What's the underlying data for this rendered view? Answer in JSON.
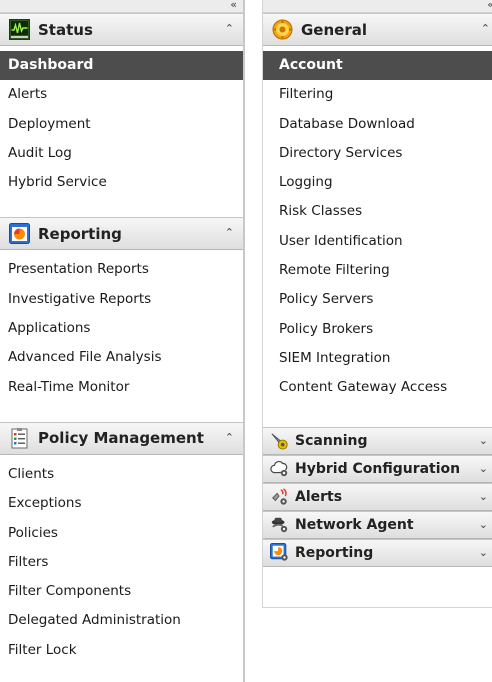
{
  "collapse_glyph": "«",
  "left_panel": {
    "sections": [
      {
        "title": "Status",
        "icon": "status-monitor-icon",
        "state": "expanded",
        "items": [
          {
            "label": "Dashboard",
            "active": true
          },
          {
            "label": "Alerts"
          },
          {
            "label": "Deployment"
          },
          {
            "label": "Audit Log"
          },
          {
            "label": "Hybrid Service"
          }
        ]
      },
      {
        "title": "Reporting",
        "icon": "reporting-chart-icon",
        "state": "expanded",
        "items": [
          {
            "label": "Presentation Reports"
          },
          {
            "label": "Investigative Reports"
          },
          {
            "label": "Applications"
          },
          {
            "label": "Advanced File Analysis"
          },
          {
            "label": "Real-Time Monitor"
          }
        ]
      },
      {
        "title": "Policy Management",
        "icon": "policy-list-icon",
        "state": "expanded",
        "items": [
          {
            "label": "Clients"
          },
          {
            "label": "Exceptions"
          },
          {
            "label": "Policies"
          },
          {
            "label": "Filters"
          },
          {
            "label": "Filter Components"
          },
          {
            "label": "Delegated Administration"
          },
          {
            "label": "Filter Lock"
          }
        ]
      }
    ]
  },
  "right_panel": {
    "general": {
      "title": "General",
      "icon": "general-gear-icon",
      "state": "expanded",
      "items": [
        {
          "label": "Account",
          "active": true
        },
        {
          "label": "Filtering"
        },
        {
          "label": "Database Download"
        },
        {
          "label": "Directory Services"
        },
        {
          "label": "Logging"
        },
        {
          "label": "Risk Classes"
        },
        {
          "label": "User Identification"
        },
        {
          "label": "Remote Filtering"
        },
        {
          "label": "Policy Servers"
        },
        {
          "label": "Policy Brokers"
        },
        {
          "label": "SIEM Integration"
        },
        {
          "label": "Content Gateway Access"
        }
      ]
    },
    "collapsed_sections": [
      {
        "title": "Scanning",
        "icon": "scanning-icon"
      },
      {
        "title": "Hybrid Configuration",
        "icon": "hybrid-cloud-icon"
      },
      {
        "title": "Alerts",
        "icon": "alerts-icon"
      },
      {
        "title": "Network Agent",
        "icon": "network-agent-icon"
      },
      {
        "title": "Reporting",
        "icon": "reporting-settings-icon"
      }
    ]
  }
}
